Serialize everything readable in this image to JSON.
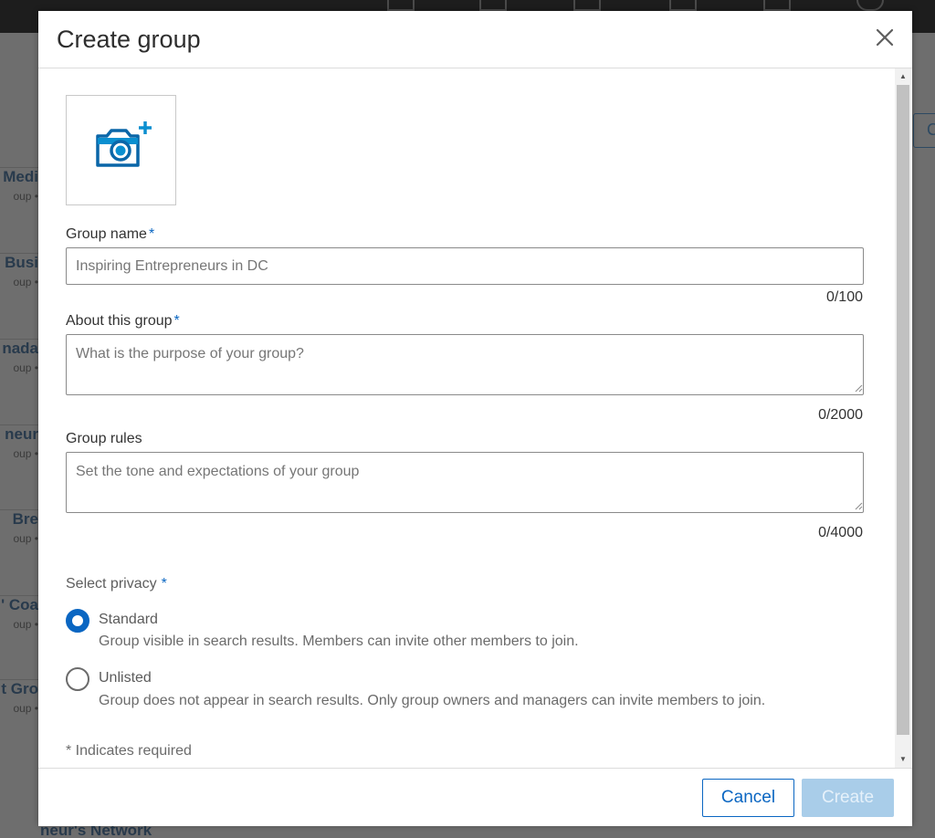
{
  "modal": {
    "title": "Create group",
    "close_label": "×"
  },
  "form": {
    "group_name": {
      "label": "Group name",
      "required_mark": "*",
      "placeholder": "Inspiring Entrepreneurs in DC",
      "value": "",
      "counter": "0/100"
    },
    "about": {
      "label": "About this group",
      "required_mark": "*",
      "placeholder": "What is the purpose of your group?",
      "value": "",
      "counter": "0/2000"
    },
    "rules": {
      "label": "Group rules",
      "placeholder": "Set the tone and expectations of your group",
      "value": "",
      "counter": "0/4000"
    },
    "privacy": {
      "label": "Select privacy",
      "required_mark": "*",
      "selected": "standard",
      "options": [
        {
          "id": "standard",
          "title": "Standard",
          "description": "Group visible in search results. Members can invite other members to join."
        },
        {
          "id": "unlisted",
          "title": "Unlisted",
          "description": "Group does not appear in search results. Only group owners and managers can invite members to join."
        }
      ]
    },
    "required_note": "* Indicates required"
  },
  "footer": {
    "cancel_label": "Cancel",
    "create_label": "Create"
  },
  "background": {
    "list_items": [
      {
        "title": "Medi",
        "sub": "oup •"
      },
      {
        "title": "Busi",
        "sub": "oup •"
      },
      {
        "title": "nada",
        "sub": "oup •"
      },
      {
        "title": "neur",
        "sub": "oup •"
      },
      {
        "title": "Bre",
        "sub": "oup •"
      },
      {
        "title": "' Coa",
        "sub": "oup •"
      },
      {
        "title": "t Gro",
        "sub": "oup •"
      }
    ],
    "bottom_title": "neur's Network",
    "right_button_label": "C"
  },
  "icons": {
    "camera_add": "camera-plus-icon",
    "close": "close-icon"
  },
  "colors": {
    "accent": "#0a66c2",
    "create_disabled_bg": "#a9cde9",
    "overlay": "#6e6e6e"
  }
}
